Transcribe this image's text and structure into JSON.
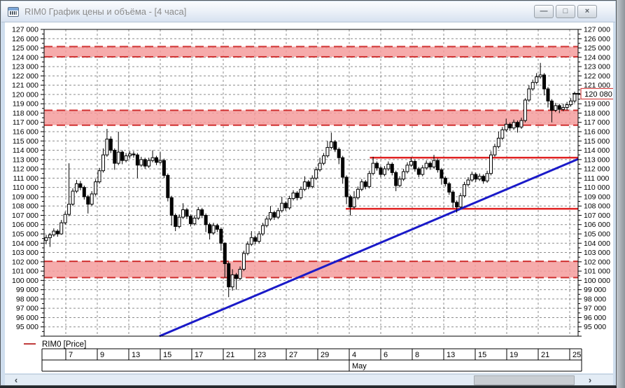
{
  "window": {
    "title": "RIM0 График цены и объёма - [4 часа]"
  },
  "icons": {
    "app_icon": "chart-icon",
    "minimize": "—",
    "maximize": "□",
    "close": "×",
    "scroll_left": "‹",
    "scroll_right": "›"
  },
  "legend": {
    "label": "RIM0 [Price]",
    "series_color": "#c03c3c"
  },
  "chart_data": {
    "type": "candlestick",
    "instrument": "RIM0",
    "timeframe_label": "4 часа",
    "title": "RIM0 График цены и объёма - [4 часа]",
    "grid": true,
    "y_axis": {
      "min": 95000,
      "max": 127000,
      "tick_step": 1000,
      "minor_tick_step": 500,
      "sides": [
        "left",
        "right"
      ]
    },
    "x_axis": {
      "day_labels": [
        "",
        "7",
        "9",
        "13",
        "15",
        "17",
        "21",
        "23",
        "27",
        "29",
        "4",
        "6",
        "8",
        "13",
        "15",
        "19",
        "21",
        "25"
      ],
      "month_label": "May",
      "month_starts_at_cell": 10
    },
    "last_price": 120080,
    "last_price_label": "120 080",
    "resistance_bands": [
      {
        "from": 124050,
        "to": 125150
      },
      {
        "from": 116700,
        "to": 118300
      },
      {
        "from": 100300,
        "to": 102050
      }
    ],
    "h_lines": [
      {
        "price": 113200,
        "start_frac": 0.61
      },
      {
        "price": 107700,
        "start_frac": 0.565
      }
    ],
    "trend_line": {
      "start_frac": 0.216,
      "start_price": 94000,
      "end_frac": 1.0,
      "end_price": 113050
    },
    "colors": {
      "band_fill": "#f59c9c",
      "band_edge": "#d03030",
      "h_line": "#e02020",
      "trend_line": "#1a1ac8",
      "grid": "#8c8c8c",
      "candle_up_fill": "#ffffff",
      "candle_down_fill": "#000000",
      "candle_stroke": "#000000",
      "price_badge": "#cc2020"
    },
    "candles": [
      [
        104300,
        104900,
        103900,
        104600
      ],
      [
        104600,
        105100,
        103600,
        104900
      ],
      [
        104900,
        105600,
        104700,
        105300
      ],
      [
        105300,
        105500,
        104700,
        105000
      ],
      [
        105000,
        106500,
        104900,
        106200
      ],
      [
        106200,
        107400,
        106000,
        107100
      ],
      [
        107100,
        112600,
        106900,
        108200
      ],
      [
        108200,
        109900,
        108000,
        109600
      ],
      [
        109600,
        110800,
        109400,
        110400
      ],
      [
        110400,
        110700,
        109700,
        110000
      ],
      [
        110000,
        110200,
        108700,
        109000
      ],
      [
        109000,
        109200,
        107200,
        108200
      ],
      [
        108200,
        109600,
        108000,
        109300
      ],
      [
        109300,
        110900,
        109100,
        110600
      ],
      [
        110600,
        112100,
        110400,
        111800
      ],
      [
        111800,
        114200,
        111600,
        113500
      ],
      [
        113500,
        116300,
        113300,
        115200
      ],
      [
        115200,
        115500,
        113700,
        114000
      ],
      [
        114000,
        114200,
        111900,
        112600
      ],
      [
        112600,
        116000,
        112400,
        113800
      ],
      [
        113800,
        114000,
        112500,
        112900
      ],
      [
        112900,
        113700,
        112700,
        113400
      ],
      [
        113400,
        113900,
        113100,
        113600
      ],
      [
        113600,
        113900,
        113200,
        113500
      ],
      [
        113500,
        113700,
        111000,
        112400
      ],
      [
        112400,
        113300,
        112200,
        113000
      ],
      [
        113000,
        113200,
        112000,
        112300
      ],
      [
        112300,
        113200,
        112100,
        112900
      ],
      [
        112900,
        114000,
        112700,
        113200
      ],
      [
        113200,
        113400,
        112400,
        112700
      ],
      [
        112700,
        113800,
        112500,
        112900
      ],
      [
        112900,
        113100,
        111000,
        111300
      ],
      [
        111300,
        111500,
        108500,
        108900
      ],
      [
        108900,
        109100,
        105900,
        107000
      ],
      [
        107000,
        107200,
        105300,
        105800
      ],
      [
        105800,
        107100,
        105600,
        106800
      ],
      [
        106800,
        108300,
        106600,
        107600
      ],
      [
        107600,
        107800,
        106600,
        106900
      ],
      [
        106900,
        107100,
        105800,
        106100
      ],
      [
        106100,
        107000,
        105900,
        106700
      ],
      [
        106700,
        107900,
        106500,
        107600
      ],
      [
        107600,
        107800,
        106700,
        107000
      ],
      [
        107000,
        107200,
        105200,
        106000
      ],
      [
        106000,
        106200,
        104400,
        105100
      ],
      [
        105100,
        106200,
        104900,
        105900
      ],
      [
        105900,
        106100,
        105200,
        105500
      ],
      [
        105500,
        105700,
        103200,
        104000
      ],
      [
        104000,
        104100,
        100300,
        101800
      ],
      [
        101800,
        102000,
        98200,
        99300
      ],
      [
        99300,
        101200,
        98900,
        100600
      ],
      [
        100600,
        100800,
        99000,
        100200
      ],
      [
        100200,
        101500,
        100000,
        101200
      ],
      [
        101200,
        103200,
        101000,
        102900
      ],
      [
        102900,
        104200,
        102700,
        103900
      ],
      [
        103900,
        105300,
        103700,
        104600
      ],
      [
        104600,
        104800,
        103900,
        104200
      ],
      [
        104200,
        105300,
        104000,
        105000
      ],
      [
        105000,
        106200,
        104800,
        105900
      ],
      [
        105900,
        106900,
        105700,
        106600
      ],
      [
        106600,
        108000,
        106400,
        107300
      ],
      [
        107300,
        107500,
        106500,
        106800
      ],
      [
        106800,
        107800,
        106600,
        107500
      ],
      [
        107500,
        109000,
        107300,
        108300
      ],
      [
        108300,
        108500,
        107500,
        107800
      ],
      [
        107800,
        109100,
        107600,
        108800
      ],
      [
        108800,
        109700,
        108600,
        109400
      ],
      [
        109400,
        109600,
        108600,
        108900
      ],
      [
        108900,
        110100,
        108700,
        109800
      ],
      [
        109800,
        111200,
        109600,
        110600
      ],
      [
        110600,
        110800,
        109800,
        110100
      ],
      [
        110100,
        111300,
        109900,
        111000
      ],
      [
        111000,
        112200,
        110800,
        111900
      ],
      [
        111900,
        113200,
        111700,
        112600
      ],
      [
        112600,
        113700,
        112400,
        113400
      ],
      [
        113400,
        115000,
        113200,
        114300
      ],
      [
        114300,
        115900,
        114100,
        114900
      ],
      [
        114900,
        115100,
        113800,
        114100
      ],
      [
        114100,
        114300,
        112500,
        113200
      ],
      [
        113200,
        113400,
        110400,
        111100
      ],
      [
        111100,
        111300,
        108200,
        109000
      ],
      [
        109000,
        109200,
        107000,
        107900
      ],
      [
        107900,
        109600,
        107700,
        108900
      ],
      [
        108900,
        110100,
        108700,
        109800
      ],
      [
        109800,
        110900,
        109600,
        110600
      ],
      [
        110600,
        110800,
        109800,
        110100
      ],
      [
        110100,
        111800,
        109900,
        111500
      ],
      [
        111500,
        113300,
        111300,
        112600
      ],
      [
        112600,
        112800,
        111800,
        112100
      ],
      [
        112100,
        112300,
        111100,
        111400
      ],
      [
        111400,
        112300,
        111200,
        112000
      ],
      [
        112000,
        112800,
        111800,
        112500
      ],
      [
        112500,
        112700,
        111300,
        111600
      ],
      [
        111600,
        111800,
        109600,
        110200
      ],
      [
        110200,
        111200,
        110000,
        110900
      ],
      [
        110900,
        112000,
        110700,
        111700
      ],
      [
        111700,
        112700,
        111500,
        112400
      ],
      [
        112400,
        113200,
        112200,
        112800
      ],
      [
        112800,
        113000,
        111700,
        112000
      ],
      [
        112000,
        112200,
        111100,
        111400
      ],
      [
        111400,
        112400,
        111200,
        112100
      ],
      [
        112100,
        112900,
        111900,
        112600
      ],
      [
        112600,
        112800,
        111900,
        112200
      ],
      [
        112200,
        113500,
        112000,
        112900
      ],
      [
        112900,
        113100,
        111600,
        111900
      ],
      [
        111900,
        112100,
        110300,
        111000
      ],
      [
        111000,
        111200,
        110100,
        110400
      ],
      [
        110400,
        110600,
        109200,
        109500
      ],
      [
        109500,
        109700,
        107800,
        108400
      ],
      [
        108400,
        108600,
        107300,
        107900
      ],
      [
        107900,
        109400,
        107700,
        109100
      ],
      [
        109100,
        110600,
        108900,
        110300
      ],
      [
        110300,
        111100,
        110100,
        110800
      ],
      [
        110800,
        111700,
        110600,
        111400
      ],
      [
        111400,
        111600,
        110600,
        110900
      ],
      [
        110900,
        111500,
        110700,
        111200
      ],
      [
        111200,
        111400,
        110400,
        110700
      ],
      [
        110700,
        111800,
        110500,
        111500
      ],
      [
        111500,
        113900,
        111300,
        113500
      ],
      [
        113500,
        114700,
        113300,
        114400
      ],
      [
        114400,
        116000,
        114200,
        115300
      ],
      [
        115300,
        116500,
        115100,
        116200
      ],
      [
        116200,
        117400,
        116000,
        116800
      ],
      [
        116800,
        117000,
        116100,
        116400
      ],
      [
        116400,
        117300,
        116200,
        117000
      ],
      [
        117000,
        117200,
        115900,
        116500
      ],
      [
        116500,
        117500,
        116300,
        117200
      ],
      [
        117200,
        119600,
        117000,
        119400
      ],
      [
        119400,
        121000,
        119200,
        120600
      ],
      [
        120600,
        121600,
        120400,
        121300
      ],
      [
        121300,
        122300,
        121100,
        121900
      ],
      [
        121900,
        123400,
        121700,
        122100
      ],
      [
        122100,
        122300,
        119900,
        120600
      ],
      [
        120600,
        120800,
        118600,
        119300
      ],
      [
        119300,
        119500,
        117000,
        118300
      ],
      [
        118300,
        119100,
        118100,
        118800
      ],
      [
        118800,
        119000,
        118000,
        118400
      ],
      [
        118400,
        119000,
        118200,
        118600
      ],
      [
        118600,
        119200,
        118300,
        118900
      ],
      [
        118900,
        119600,
        118700,
        119300
      ],
      [
        119300,
        120300,
        119100,
        120080
      ]
    ]
  },
  "scrollbar": {
    "orientation": "horizontal"
  }
}
